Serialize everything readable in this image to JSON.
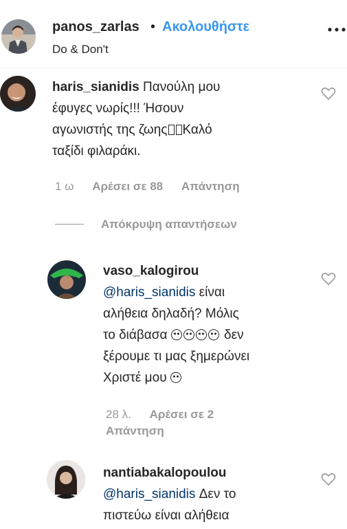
{
  "post": {
    "author": "panos_zarlas",
    "dot": "•",
    "follow_label": "Ακολουθήστε",
    "subtitle": "Do & Don't"
  },
  "comments": [
    {
      "username": "haris_sianidis",
      "line1": "Πανούλη μου",
      "line2": "έφυγες νωρίς!!! Ήσουν",
      "line3a": "αγωνιστής της ζωης",
      "line3b": "Καλό",
      "line4": "ταξίδι φιλαράκι.",
      "time": "1 ω",
      "likes": "Αρέσει σε 88",
      "reply_label": "Απάντηση"
    }
  ],
  "hide_replies_label": "Απόκρυψη απαντήσεων",
  "replies": [
    {
      "username": "vaso_kalogirou",
      "mention": "@haris_sianidis",
      "line1_rest": " είναι",
      "line2": "αλήθεια δηλαδή? Μόλις",
      "line3a": "το διάβασα ",
      "line3b": " δεν",
      "line4": "ξέρουμε τι μας ξημερώνει",
      "line5": "Χριστέ μου ",
      "time": "28 λ.",
      "likes": "Αρέσει σε 2",
      "reply_label": "Απάντηση"
    },
    {
      "username": "nantiabakalopoulou",
      "mention": "@haris_sianidis",
      "line1_rest": " Δεν το",
      "line2": "πιστεύω είναι αλήθεια"
    }
  ],
  "icons": {
    "more": "more-options-icon",
    "heart": "heart-icon",
    "emoji": "sad-face-emoji-icon"
  },
  "colors": {
    "link": "#3897f0",
    "mention": "#003569",
    "meta": "#999999",
    "text": "#262626"
  }
}
